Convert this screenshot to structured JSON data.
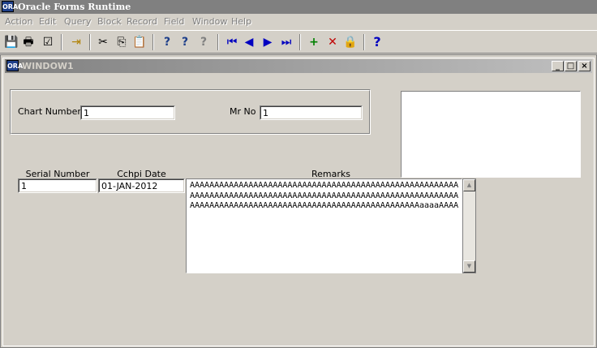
{
  "app": {
    "title": "Oracle Forms Runtime",
    "icon_text": "ORA"
  },
  "menu": [
    "Action",
    "Edit",
    "Query",
    "Block",
    "Record",
    "Field",
    "Window",
    "Help"
  ],
  "toolbar": {
    "icons": [
      "save-icon",
      "print-icon",
      "close-form-icon",
      "exit-icon",
      "cut-icon",
      "copy-icon",
      "paste-icon",
      "enter-query-icon",
      "execute-query-icon",
      "cancel-query-icon",
      "previous-block-icon",
      "previous-record-icon",
      "next-record-icon",
      "next-block-icon",
      "insert-record-icon",
      "delete-record-icon",
      "lock-record-icon",
      "help-icon"
    ],
    "glyphs": {
      "save": "💾",
      "print": "🖶",
      "close": "☑",
      "exit": "⇥",
      "cut": "✂",
      "copy": "⎘",
      "paste": "📋",
      "enterq": "?",
      "execq": "?",
      "cancelq": "?",
      "prevblock": "⏮",
      "prevrec": "◀",
      "nextrec": "▶",
      "nextblock": "⏭",
      "insert": "+",
      "delete": "✕",
      "lock": "🔒",
      "help": "?"
    }
  },
  "window": {
    "title": "WINDOW1",
    "min": "_",
    "max": "□",
    "close": "×"
  },
  "header_form": {
    "chart_number_label": "Chart Number",
    "chart_number_value": "1",
    "mr_no_label": "Mr No",
    "mr_no_value": "1"
  },
  "detail": {
    "columns": {
      "serial": "Serial Number",
      "date": "Cchpi Date",
      "remarks": "Remarks"
    },
    "serial_value": "1",
    "date_value": "01-JAN-2012",
    "remarks_value": "AAAAAAAAAAAAAAAAAAAAAAAAAAAAAAAAAAAAAAAAAAAAAAAAAAAAAAAAAAAAAAAAAAAAAAAAAAAAAAAAAAAAAAAAAAAAAAAAAAAAAAAAAAAAAAAAAAAAAAAAAAAAAAAAAAAAAAAAAAAAAAAAAAAAAAAAAAAAAaaaaAAAA",
    "scroll_up": "▲",
    "scroll_down": "▼"
  }
}
